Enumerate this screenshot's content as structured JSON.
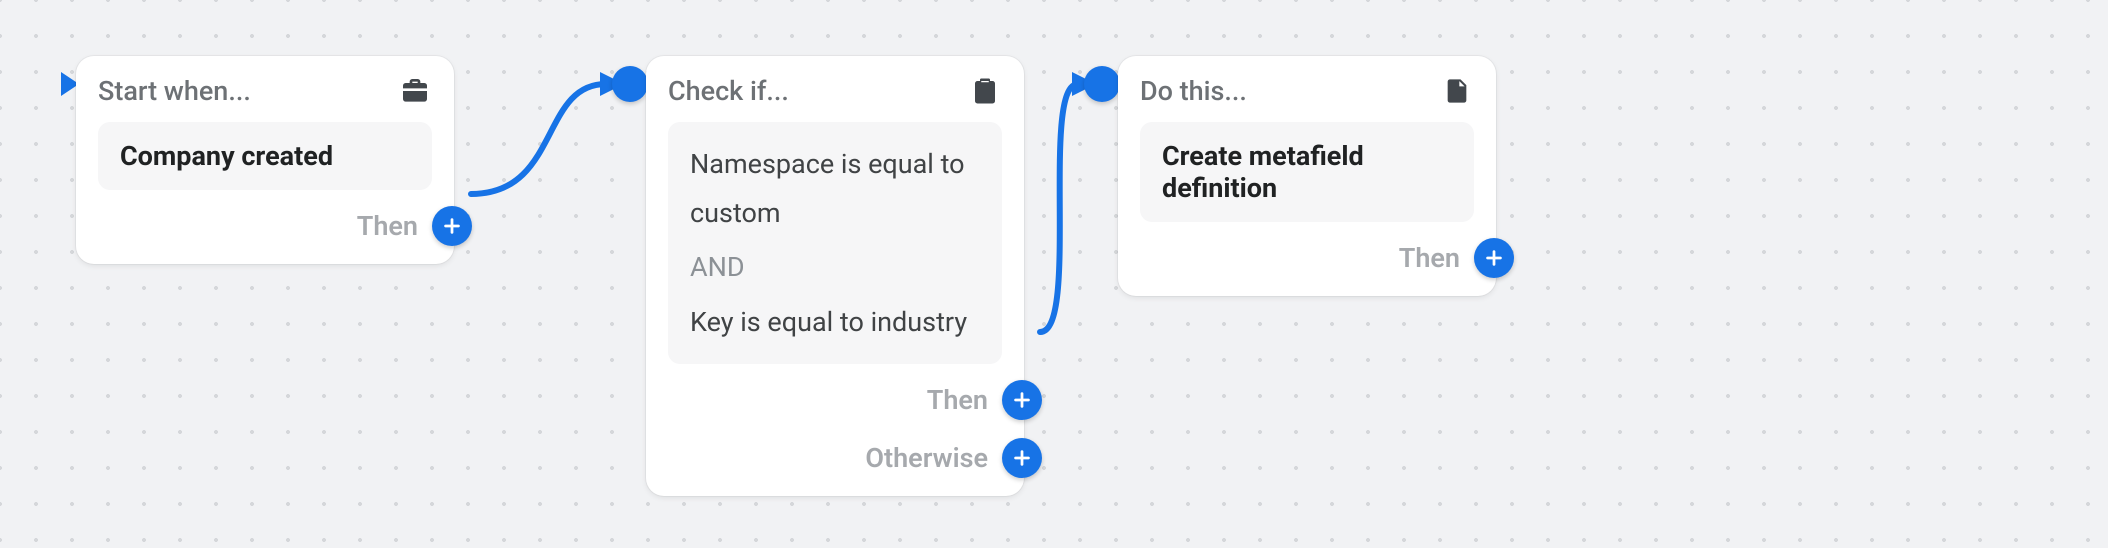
{
  "trigger": {
    "header": "Start when...",
    "content": "Company created",
    "outputs": [
      {
        "label": "Then"
      }
    ]
  },
  "condition": {
    "header": "Check if...",
    "line1": "Namespace is equal to custom",
    "joiner": "AND",
    "line2": "Key is equal to industry",
    "outputs": [
      {
        "label": "Then"
      },
      {
        "label": "Otherwise"
      }
    ]
  },
  "action": {
    "header": "Do this...",
    "content": "Create metafield definition",
    "outputs": [
      {
        "label": "Then"
      }
    ]
  }
}
